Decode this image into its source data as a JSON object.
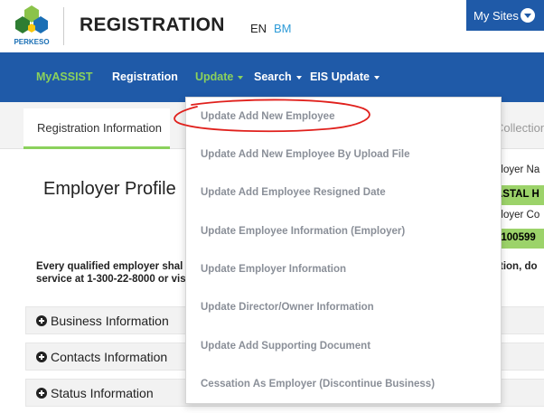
{
  "header": {
    "logo_text": "PERKESO",
    "title": "REGISTRATION",
    "lang_en": "EN",
    "lang_bm": "BM",
    "my_sites": "My Sites"
  },
  "nav": {
    "items": [
      "MyASSIST",
      "Registration",
      "Update",
      "Search",
      "EIS Update"
    ]
  },
  "tabs": {
    "active": "Registration Information",
    "partial": "Collection"
  },
  "main": {
    "heading": "Employer Profile",
    "notice_line1": "Every qualified employer shal",
    "notice_line1_tail": "tion, do",
    "notice_line2": "service at 1-300-22-8000 or vis",
    "panels": [
      "Business Information",
      "Contacts Information",
      "Status Information"
    ]
  },
  "side": {
    "employer_name_label": "ployer Na",
    "employer_name_value": "ASTAL H",
    "employer_code_label": "ployer Co",
    "employer_code_value": "0100599"
  },
  "dropdown": {
    "items": [
      "Update Add New Employee",
      "Update Add New Employee By Upload File",
      "Update Add Employee Resigned Date",
      "Update Employee Information (Employer)",
      "Update Employer Information",
      "Update Director/Owner Information",
      "Update Add Supporting Document",
      "Cessation As Employer (Discontinue Business)"
    ]
  },
  "colors": {
    "nav_blue": "#1f5aa8",
    "accent_green": "#8bd15c",
    "annotation_red": "#e0201c"
  }
}
